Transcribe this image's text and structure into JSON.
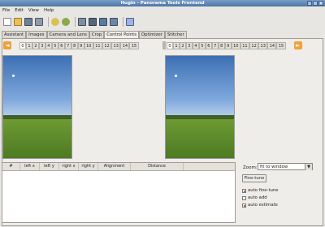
{
  "window": {
    "title": "Hugin - Panorama Tools Frontend"
  },
  "menu": [
    "File",
    "Edit",
    "View",
    "Help"
  ],
  "tabs": [
    "Assistant",
    "Images",
    "Camera and Lens",
    "Crop",
    "Control Points",
    "Optimizer",
    "Stitcher"
  ],
  "active_tab": "Control Points",
  "image_numbers": [
    "0",
    "1",
    "2",
    "3",
    "4",
    "5",
    "6",
    "7",
    "8",
    "9",
    "10",
    "11",
    "12",
    "13",
    "14",
    "15"
  ],
  "left_selected": "0",
  "right_selected": "0",
  "table": {
    "headers": [
      "#",
      "left x",
      "left y",
      "right x",
      "right y",
      "Alignment",
      "Distance"
    ]
  },
  "side": {
    "zoom_label": "Zoom:",
    "zoom_value": "fit to window",
    "finetune_label": "Fine-tune",
    "checks": [
      {
        "label": "auto fine-tune",
        "checked": true
      },
      {
        "label": "auto add",
        "checked": false
      },
      {
        "label": "auto estimate",
        "checked": true
      }
    ]
  },
  "colors": {
    "accent": "#f1a035",
    "sky": "#4a7bbf",
    "grass": "#5d8a2b"
  }
}
